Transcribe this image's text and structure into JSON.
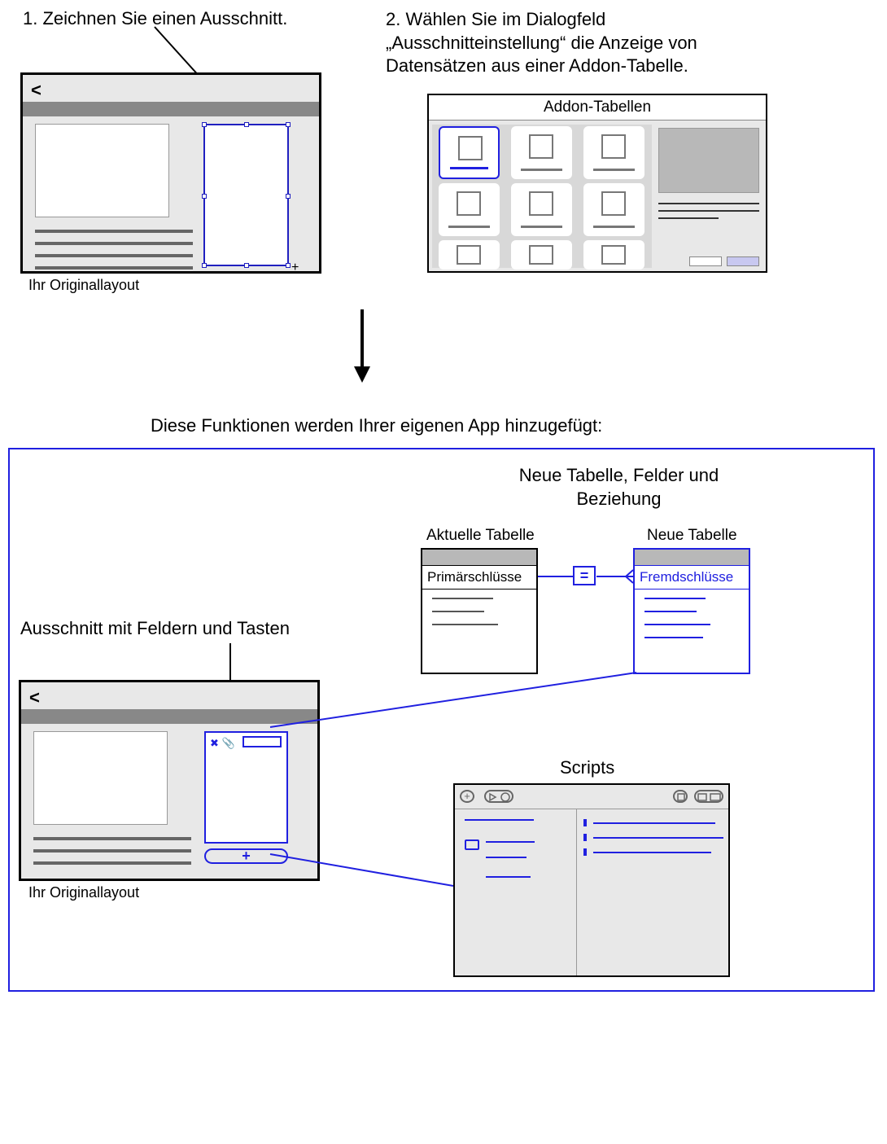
{
  "step1": {
    "label": "1. Zeichnen Sie einen Ausschnitt.",
    "caption": "Ihr Originallayout",
    "back_symbol": "<"
  },
  "step2": {
    "label": "2. Wählen Sie im Dialogfeld „Ausschnitteinstellung“ die Anzeige von Datensätzen aus einer Addon-Tabelle.",
    "dialog_title": "Addon-Tabellen"
  },
  "added_label": "Diese Funktionen werden Ihrer eigenen App hinzugefügt:",
  "portal_section": {
    "title": "Ausschnitt mit Feldern und Tasten",
    "caption": "Ihr Originallayout",
    "back_symbol": "<",
    "add_symbol": "+"
  },
  "tables": {
    "heading": "Neue Tabelle, Felder und Beziehung",
    "current_label": "Aktuelle Tabelle",
    "new_label": "Neue Tabelle",
    "primary_key": "Primärschlüsse",
    "foreign_key": "Fremdschlüsse",
    "relation_op": "="
  },
  "scripts": {
    "heading": "Scripts"
  }
}
